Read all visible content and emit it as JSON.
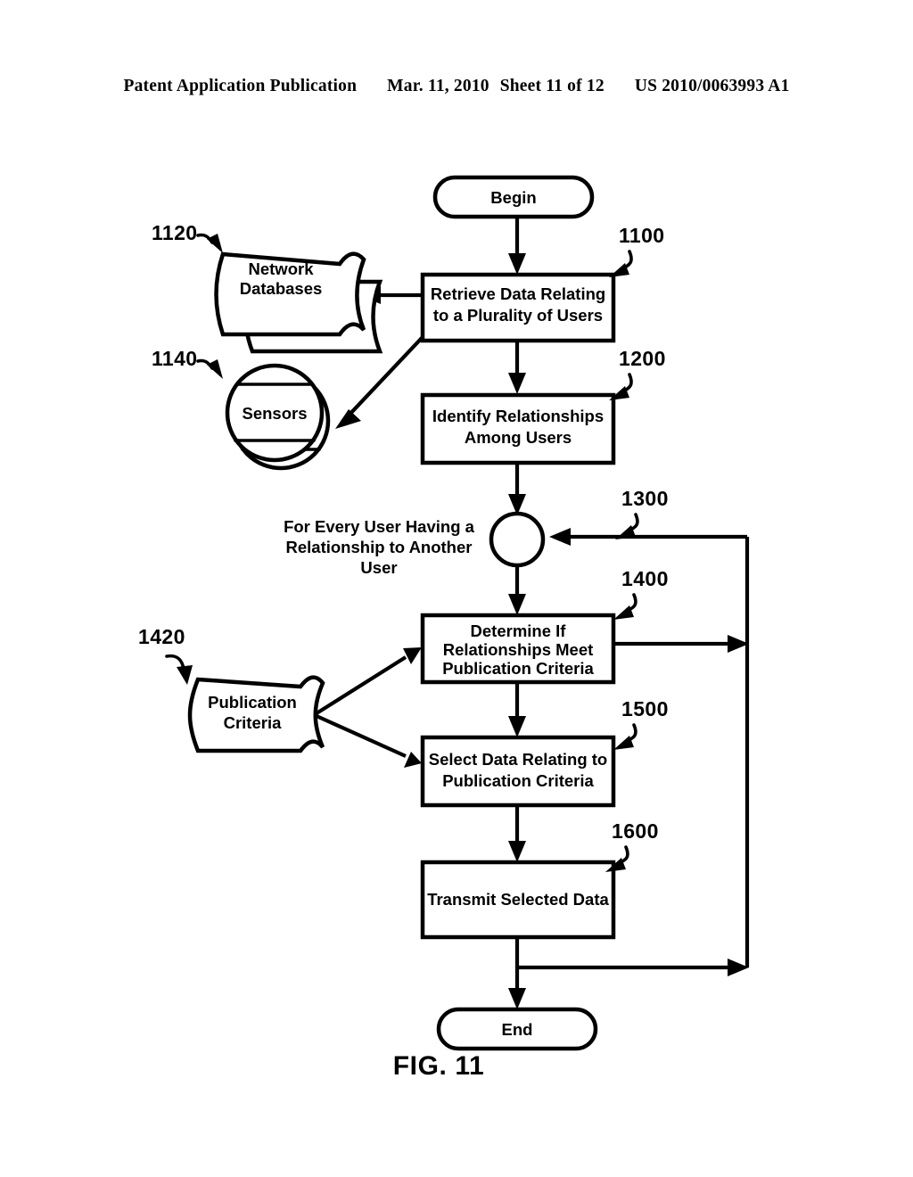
{
  "header": {
    "publication": "Patent Application Publication",
    "date": "Mar. 11, 2010",
    "sheet": "Sheet 11 of 12",
    "doc_number": "US 2010/0063993 A1"
  },
  "figure": {
    "caption": "FIG. 11",
    "colors": {
      "ink": "#000000",
      "paper": "#ffffff"
    },
    "nodes": {
      "begin": {
        "label": "Begin",
        "shape": "terminator"
      },
      "end": {
        "label": "End",
        "shape": "terminator"
      },
      "retrieve": {
        "label_line1": "Retrieve Data Relating",
        "label_line2": "to a Plurality of Users",
        "ref": "1100",
        "shape": "process"
      },
      "identify": {
        "label_line1": "Identify Relationships",
        "label_line2": "Among Users",
        "ref": "1200",
        "shape": "process"
      },
      "loop": {
        "label_line1": "For Every User Having a",
        "label_line2": "Relationship to Another",
        "label_line3": "User",
        "ref": "1300",
        "shape": "connector-circle"
      },
      "determine": {
        "label_line1": "Determine If",
        "label_line2": "Relationships Meet",
        "label_line3": "Publication Criteria",
        "ref": "1400",
        "shape": "process"
      },
      "select": {
        "label_line1": "Select Data Relating to",
        "label_line2": "Publication Criteria",
        "ref": "1500",
        "shape": "process"
      },
      "transmit": {
        "label_line1": "Transmit Selected Data",
        "ref": "1600",
        "shape": "process"
      },
      "network_databases": {
        "label_line1": "Network",
        "label_line2": "Databases",
        "ref": "1120",
        "shape": "stacked-document"
      },
      "sensors": {
        "label_line1": "Sensors",
        "ref": "1140",
        "shape": "direct-access-storage"
      },
      "publication_criteria": {
        "label_line1": "Publication",
        "label_line2": "Criteria",
        "ref": "1420",
        "shape": "document"
      }
    }
  }
}
